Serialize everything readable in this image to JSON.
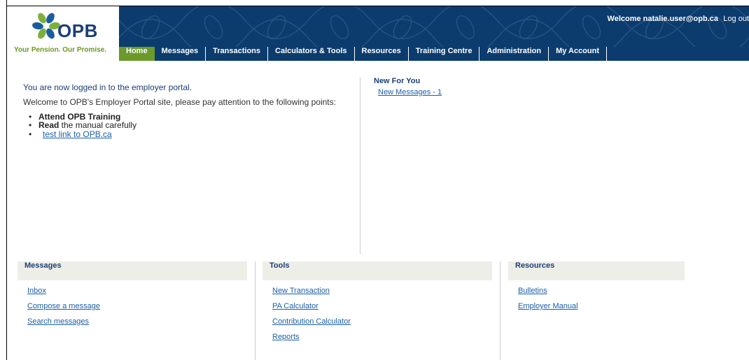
{
  "logo": {
    "text": "OPB",
    "tagline": "Your Pension. Our Promise."
  },
  "header": {
    "welcome": "Welcome natalie.user@opb.ca",
    "logout": "Log out"
  },
  "nav": [
    {
      "label": "Home",
      "active": true
    },
    {
      "label": "Messages"
    },
    {
      "label": "Transactions"
    },
    {
      "label": "Calculators & Tools"
    },
    {
      "label": "Resources"
    },
    {
      "label": "Training Centre"
    },
    {
      "label": "Administration"
    },
    {
      "label": "My Account"
    }
  ],
  "main": {
    "logged_in": "You are now logged in to the employer portal.",
    "intro": "Welcome to OPB's Employer Portal site, please pay attention to the following points:",
    "point1_bold": "Attend OPB Training",
    "point2_bold": "Read",
    "point2_rest": " the manual carefully",
    "point3_link": "test link to OPB.ca"
  },
  "new_for_you": {
    "title": "New For You",
    "link": "New Messages - 1"
  },
  "panels": {
    "messages": {
      "title": "Messages",
      "links": [
        "Inbox",
        "Compose a message",
        "Search messages"
      ]
    },
    "tools": {
      "title": "Tools",
      "links": [
        "New Transaction",
        "PA Calculator",
        "Contribution Calculator",
        "Reports"
      ]
    },
    "resources": {
      "title": "Resources",
      "links": [
        "Bulletins",
        "Employer Manual"
      ]
    }
  },
  "colors": {
    "navy": "#0c3c6d",
    "active_tab": "#6b9a2b",
    "link": "#1c5fa8"
  }
}
